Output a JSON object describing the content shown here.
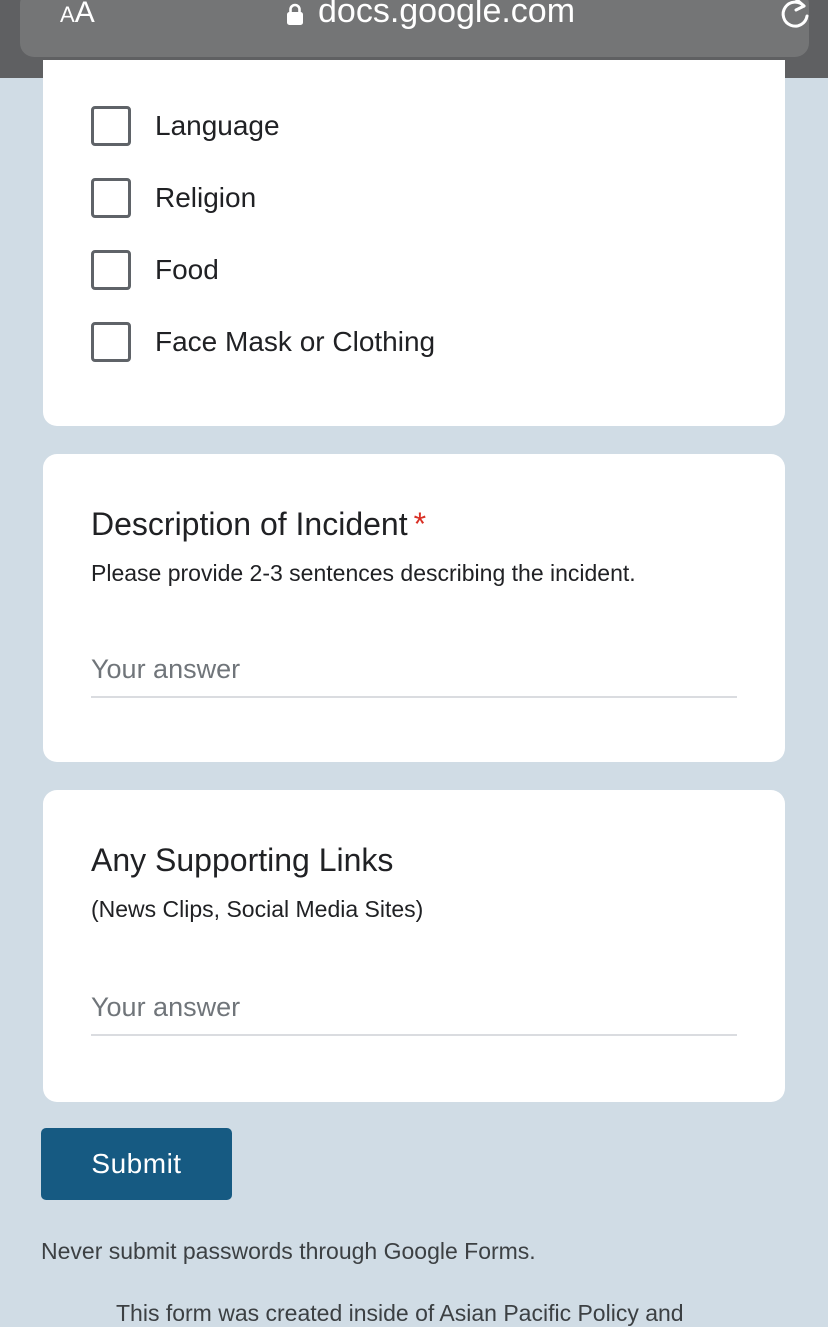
{
  "browser": {
    "text_size_button": {
      "small": "A",
      "large": "A"
    },
    "url": "docs.google.com",
    "lock_icon": "lock-icon",
    "reload_icon": "reload-icon"
  },
  "checkbox_options": [
    {
      "label": "Language",
      "checked": false
    },
    {
      "label": "Religion",
      "checked": false
    },
    {
      "label": "Food",
      "checked": false
    },
    {
      "label": "Face Mask or Clothing",
      "checked": false
    }
  ],
  "questions": [
    {
      "title": "Description of Incident",
      "required_mark": "*",
      "description": "Please provide 2-3 sentences describing the incident.",
      "placeholder": "Your answer"
    },
    {
      "title": "Any Supporting Links",
      "description": "(News Clips, Social Media Sites)",
      "placeholder": "Your answer"
    }
  ],
  "submit_label": "Submit",
  "password_note": "Never submit passwords through Google Forms.",
  "footer_text": "This form was created inside of Asian Pacific Policy and",
  "colors": {
    "page_bg": "#d0dce5",
    "submit_bg": "#165a82",
    "required": "#d93025"
  }
}
